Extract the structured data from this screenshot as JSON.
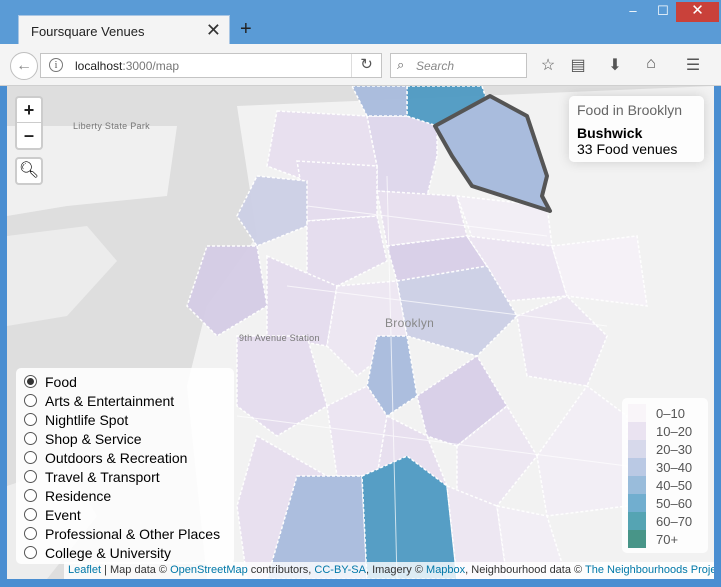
{
  "browser": {
    "tab_title": "Foursquare Venues",
    "tab_close": "✕",
    "new_tab": "+",
    "url_host": "localhost",
    "url_path": ":3000/map",
    "search_placeholder": "Search",
    "window_min": "–",
    "window_max": "☐",
    "window_close": "✕"
  },
  "map": {
    "zoom_in": "+",
    "zoom_out": "–",
    "labels": {
      "liberty": "Liberty State Park",
      "brooklyn": "Brooklyn",
      "ave_center": "9th Avenue Station"
    },
    "info": {
      "title": "Food in Brooklyn",
      "neighbourhood": "Bushwick",
      "count": "33 Food venues"
    },
    "layers": [
      {
        "label": "Food",
        "selected": true
      },
      {
        "label": "Arts & Entertainment",
        "selected": false
      },
      {
        "label": "Nightlife Spot",
        "selected": false
      },
      {
        "label": "Shop & Service",
        "selected": false
      },
      {
        "label": "Outdoors & Recreation",
        "selected": false
      },
      {
        "label": "Travel & Transport",
        "selected": false
      },
      {
        "label": "Residence",
        "selected": false
      },
      {
        "label": "Event",
        "selected": false
      },
      {
        "label": "Professional & Other Places",
        "selected": false
      },
      {
        "label": "College & University",
        "selected": false
      }
    ],
    "legend": [
      {
        "label": "0–10",
        "color": "#f7f2f8"
      },
      {
        "label": "10–20",
        "color": "#e5dcee"
      },
      {
        "label": "20–30",
        "color": "#cdd0e6"
      },
      {
        "label": "30–40",
        "color": "#a9bcdd"
      },
      {
        "label": "40–50",
        "color": "#7fabd2"
      },
      {
        "label": "50–60",
        "color": "#4e9ac3"
      },
      {
        "label": "60–70",
        "color": "#2a8da0"
      },
      {
        "label": "70+",
        "color": "#1a7a6a"
      }
    ],
    "attribution": {
      "leaflet": "Leaflet",
      "text1": " | Map data © ",
      "osm": "OpenStreetMap",
      "text2": " contributors, ",
      "license": "CC-BY-SA",
      "text3": ", Imagery © ",
      "mapbox": "Mapbox",
      "text4": ", Neighbourhood data © ",
      "project": "The Neighbourhoods Project"
    }
  }
}
